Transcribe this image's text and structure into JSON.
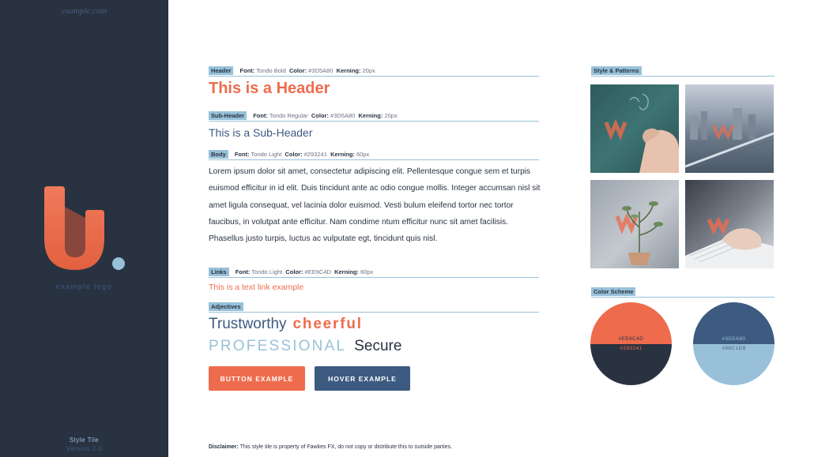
{
  "sidebar": {
    "site_url": "example.com",
    "logo_caption": "example logo",
    "tile_title": "Style Tile",
    "tile_version": "Version 2.0"
  },
  "header_spec": {
    "tag": "Header",
    "font_label": "Font:",
    "font": "Tondo Bold",
    "color_label": "Color:",
    "color": "#3D5A80",
    "kerning_label": "Kerning:",
    "kerning": "20px"
  },
  "header_sample": "This is a Header",
  "subheader_spec": {
    "tag": "Sub-Header",
    "font_label": "Font:",
    "font": "Tondo Regular",
    "color_label": "Color:",
    "color": "#3D5A80",
    "kerning_label": "Kerning:",
    "kerning": "20px"
  },
  "subheader_sample": "This is a Sub-Header",
  "body_spec": {
    "tag": "Body",
    "font_label": "Font:",
    "font": "Tondo Light",
    "color_label": "Color:",
    "color": "#293241",
    "kerning_label": "Kerning:",
    "kerning": "60px"
  },
  "body_sample": "Lorem ipsum dolor sit amet, consectetur adipiscing elit. Pellentesque congue sem et turpis euismod efficitur in id elit. Duis tincidunt ante ac odio congue mollis. Integer accumsan nisl sit amet ligula consequat, vel lacinia dolor euismod. Vesti bulum eleifend tortor nec tortor faucibus, in volutpat ante efficitur. Nam condime ntum efficitur nunc sit amet facilisis. Phasellus justo turpis, luctus ac vulputate egt, tincidunt quis nisl.",
  "links_spec": {
    "tag": "Links",
    "font_label": "Font:",
    "font": "Tondo Light",
    "color_label": "Color:",
    "color": "#EE6C4D",
    "kerning_label": "Kerning:",
    "kerning": "60px"
  },
  "link_sample": "This is a text link example",
  "adjectives": {
    "tag": "Adjectives",
    "words": [
      "Trustworthy",
      "cheerful",
      "PROFESSIONAL",
      "Secure"
    ]
  },
  "buttons": {
    "primary": "BUTTON EXAMPLE",
    "hover": "HOVER EXAMPLE"
  },
  "disclaimer": {
    "label": "Disclaimer:",
    "text": "This style tile is property of Fawkes FX, do not copy or distribute this to outside parties."
  },
  "style_patterns": {
    "tag": "Style & Patterns",
    "images": [
      "chalkboard-writing-photo",
      "city-bridge-aerial-photo",
      "potted-plant-photo",
      "keyboard-typing-photo"
    ]
  },
  "color_scheme": {
    "tag": "Color Scheme",
    "swatches": [
      {
        "top": "#EE6C4D",
        "bottom": "#293241"
      },
      {
        "top": "#3D5A80",
        "bottom": "#98C1D9"
      }
    ]
  },
  "colors": {
    "orange": "#EE6C4D",
    "navy": "#293241",
    "blue": "#3D5A80",
    "light_blue": "#98C1D9"
  }
}
